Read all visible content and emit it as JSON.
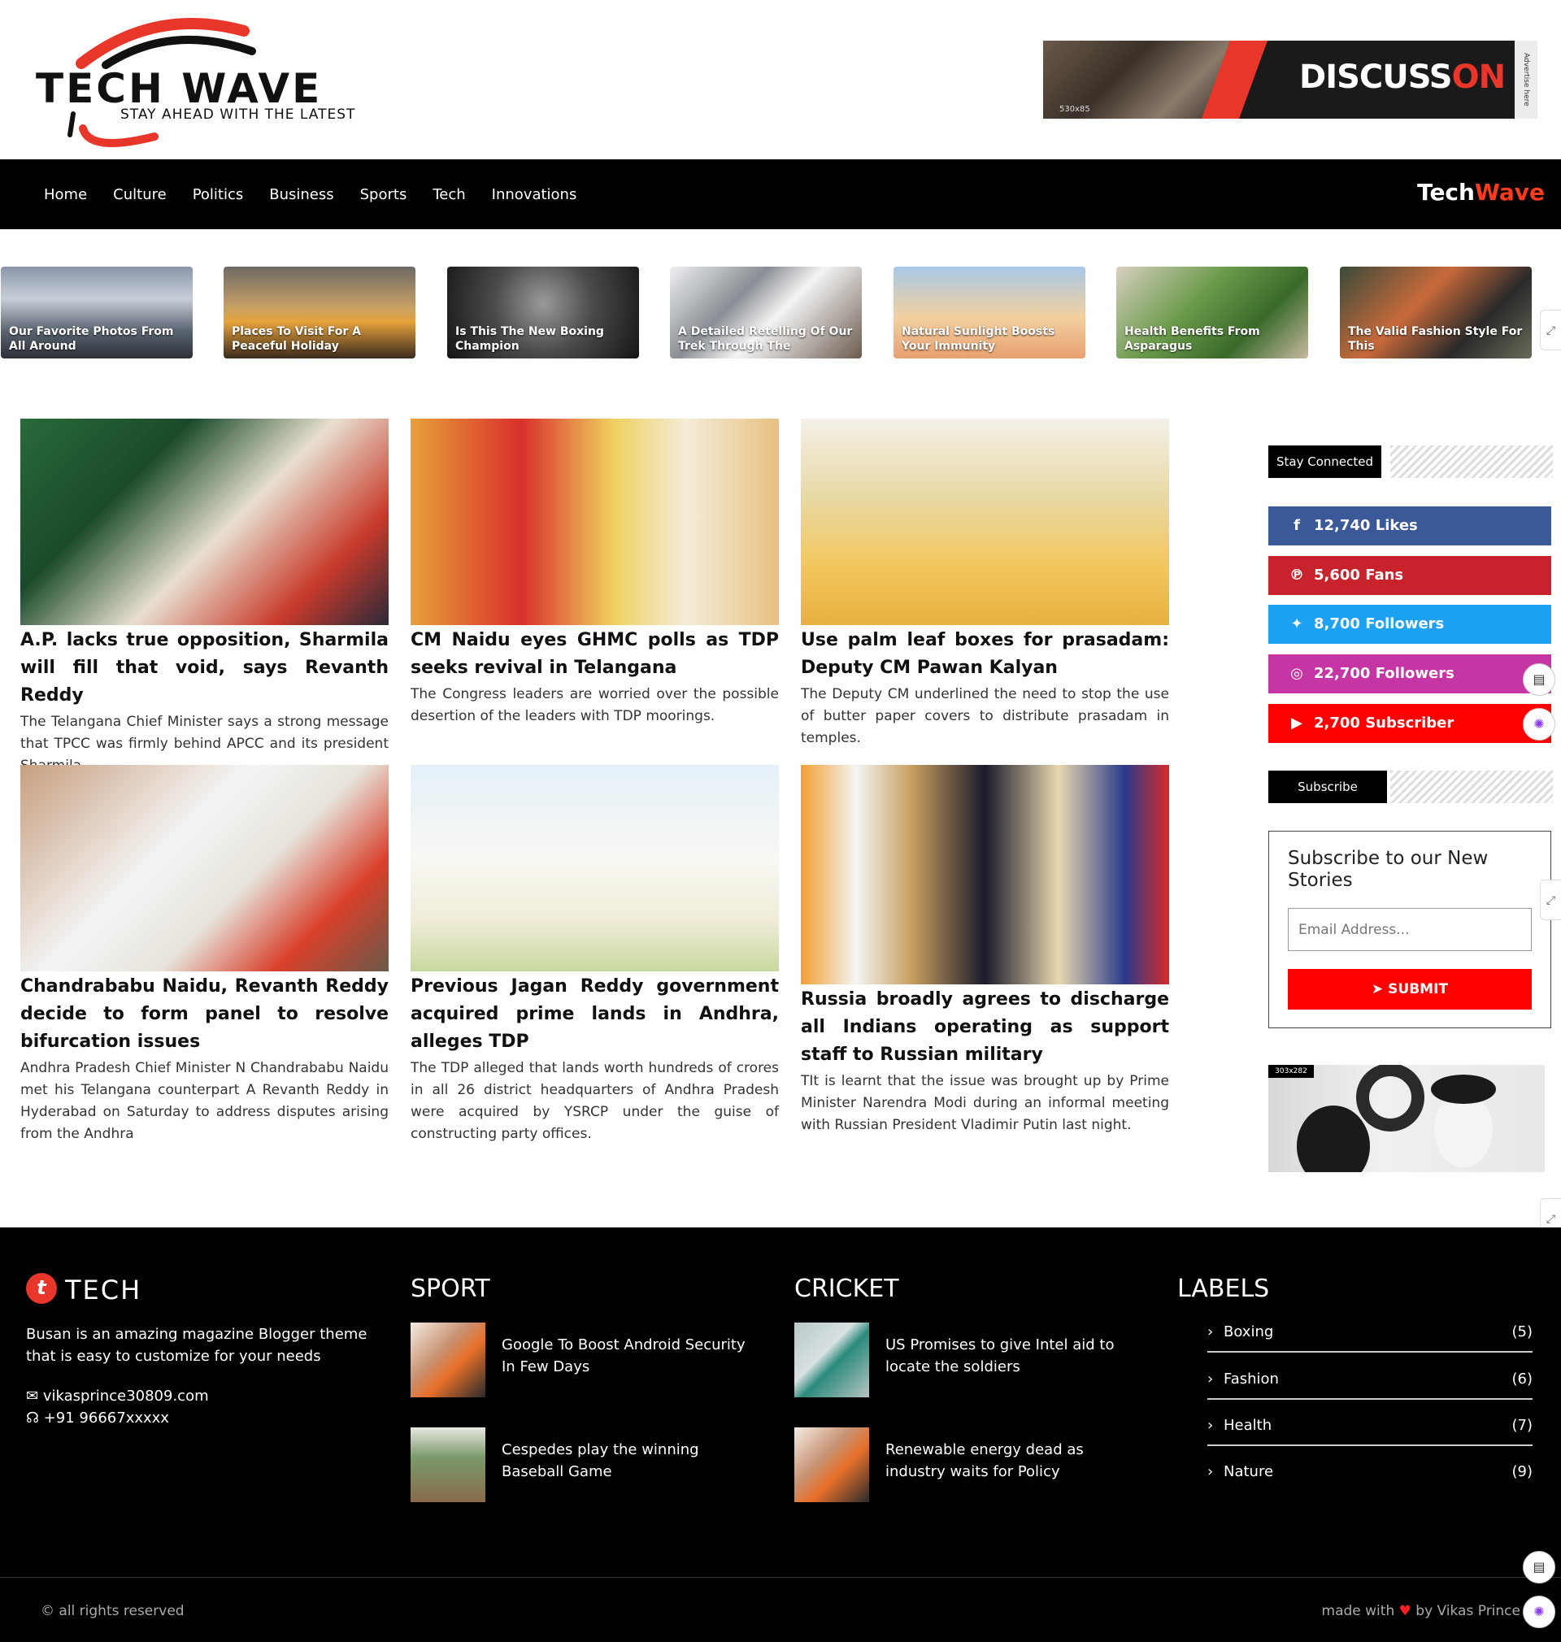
{
  "header": {
    "logo_title": "TECH WAVE",
    "logo_tagline": "STAY AHEAD WITH THE LATEST",
    "ad": {
      "brand_a": "DISCUSS",
      "brand_b": "ON",
      "dimensions": "530x85",
      "side_text": "Advertise here"
    }
  },
  "nav": {
    "items": [
      "Home",
      "Culture",
      "Politics",
      "Business",
      "Sports",
      "Tech",
      "Innovations"
    ],
    "brand_a": "Tech",
    "brand_b": "Wave"
  },
  "carousel": [
    {
      "caption": "Our Favorite Photos From All Around"
    },
    {
      "caption": "Places To Visit For A Peaceful Holiday"
    },
    {
      "caption": "Is This The New Boxing Champion"
    },
    {
      "caption": "A Detailed Retelling Of Our Trek Through The Dangerous Alps"
    },
    {
      "caption": "Natural Sunlight Boosts Your Immunity"
    },
    {
      "caption": "Health Benefits From Asparagus"
    },
    {
      "caption": "The Valid Fashion Style For This"
    }
  ],
  "posts": [
    {
      "title": "A.P. lacks true opposition, Sharmila will fill that void, says Revanth Reddy",
      "desc": "The Telangana Chief Minister says a strong message that TPCC was firmly behind APCC and its president Sharmila"
    },
    {
      "title": "CM Naidu eyes GHMC polls as TDP seeks revival in Telangana",
      "desc": "The Congress leaders are worried over the possible desertion of the leaders with TDP moorings."
    },
    {
      "title": "Use palm leaf boxes for prasadam: Deputy CM Pawan Kalyan",
      "desc": "The Deputy CM underlined the need to stop the use of butter paper covers to distribute prasadam in temples."
    },
    {
      "title": "Chandrababu Naidu, Revanth Reddy decide to form panel to resolve bifurcation issues",
      "desc": "Andhra Pradesh Chief Minister N Chandrababu Naidu met his Telangana counterpart A Revanth Reddy in Hyderabad on Saturday to address disputes arising from the Andhra"
    },
    {
      "title": "Previous Jagan Reddy government acquired prime lands in Andhra, alleges TDP",
      "desc": "The TDP alleged that lands worth hundreds of crores in all 26 district headquarters of Andhra Pradesh were acquired by YSRCP under the guise of constructing party offices."
    },
    {
      "title": "Russia broadly agrees to discharge all Indians operating as support staff to Russian military",
      "desc": "TIt is learnt that the issue was brought up by Prime Minister Narendra Modi during an informal meeting with Russian President Vladimir Putin last night."
    }
  ],
  "sidebar": {
    "stay_connected": "Stay Connected",
    "socials": [
      {
        "icon": "facebook-icon",
        "glyph": "f",
        "label": "12,740 Likes",
        "color": "#3b5998"
      },
      {
        "icon": "pinterest-icon",
        "glyph": "℗",
        "label": "5,600 Fans",
        "color": "#c8232c"
      },
      {
        "icon": "twitter-icon",
        "glyph": "🐦",
        "label": "8,700 Followers",
        "color": "#1da1f2"
      },
      {
        "icon": "instagram-icon",
        "glyph": "◎",
        "label": "22,700 Followers",
        "color": "#c536a4"
      },
      {
        "icon": "youtube-icon",
        "glyph": "▶",
        "label": "2,700 Subscriber",
        "color": "#ff0000"
      }
    ],
    "subscribe_head": "Subscribe",
    "subscribe_title": "Subscribe to our New Stories",
    "email_placeholder": "Email Address...",
    "submit_label": "SUBMIT",
    "ad_dimensions": "303x282"
  },
  "footer": {
    "logo_letter": "t",
    "logo_word": "TECH",
    "about": "Busan is an amazing magazine Blogger theme that is easy to customize for your needs",
    "email": "vikasprince30809.com",
    "phone": "+91 96667xxxxx",
    "sport_head": "SPORT",
    "sport_posts": [
      "Google To Boost Android Security In Few Days",
      "Cespedes play the winning Baseball Game"
    ],
    "cricket_head": "CRICKET",
    "cricket_posts": [
      "US Promises to give Intel aid to locate the soldiers",
      "Renewable energy dead as industry waits for Policy"
    ],
    "labels_head": "LABELS",
    "labels": [
      {
        "name": "Boxing",
        "count": "(5)"
      },
      {
        "name": "Fashion",
        "count": "(6)"
      },
      {
        "name": "Health",
        "count": "(7)"
      },
      {
        "name": "Nature",
        "count": "(9)"
      }
    ],
    "copyright": "© all rights reserved",
    "made_with": "made with",
    "made_by": "by Vikas Prince"
  },
  "colors": {
    "accent": "#e8362a",
    "nav_bg": "#000000",
    "submit": "#ff0000"
  }
}
